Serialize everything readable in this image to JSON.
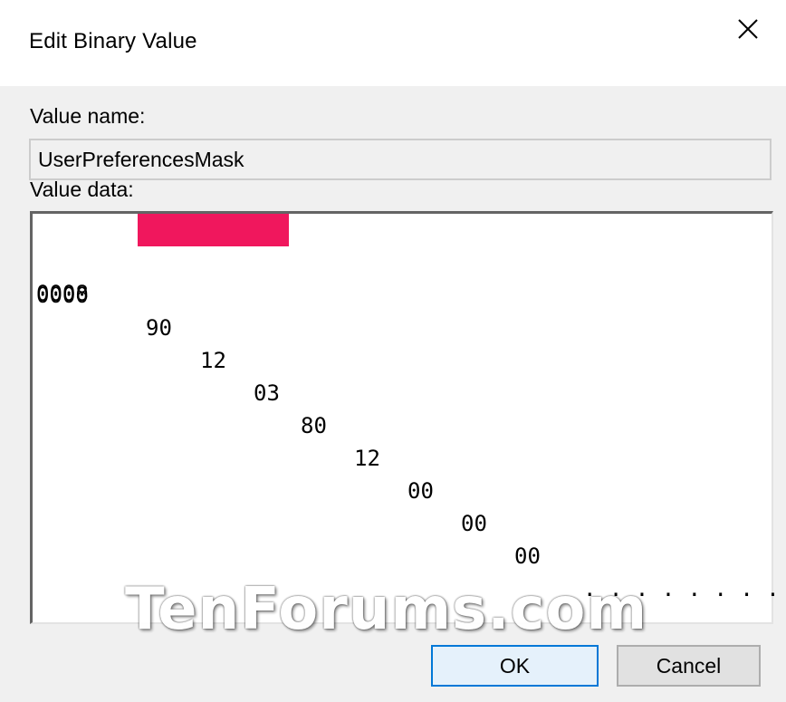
{
  "window": {
    "title": "Edit Binary Value"
  },
  "value_name": {
    "label": "Value name:",
    "value": "UserPreferencesMask"
  },
  "value_data": {
    "label": "Value data:",
    "lines": [
      {
        "address": "0000",
        "bytes": [
          "90",
          "12",
          "03",
          "80",
          "12",
          "00",
          "00",
          "00"
        ],
        "selected_bytes": [
          "90",
          "12",
          "03"
        ],
        "ascii": ". . . . . . . ."
      },
      {
        "address": "0008",
        "bytes": [],
        "ascii": ""
      }
    ],
    "selection_color": "#f0175d"
  },
  "watermark": "TenForums.com",
  "buttons": {
    "ok": "OK",
    "cancel": "Cancel"
  },
  "colors": {
    "ok_border": "#0078d7",
    "dialog_bg": "#f0f0f0"
  }
}
